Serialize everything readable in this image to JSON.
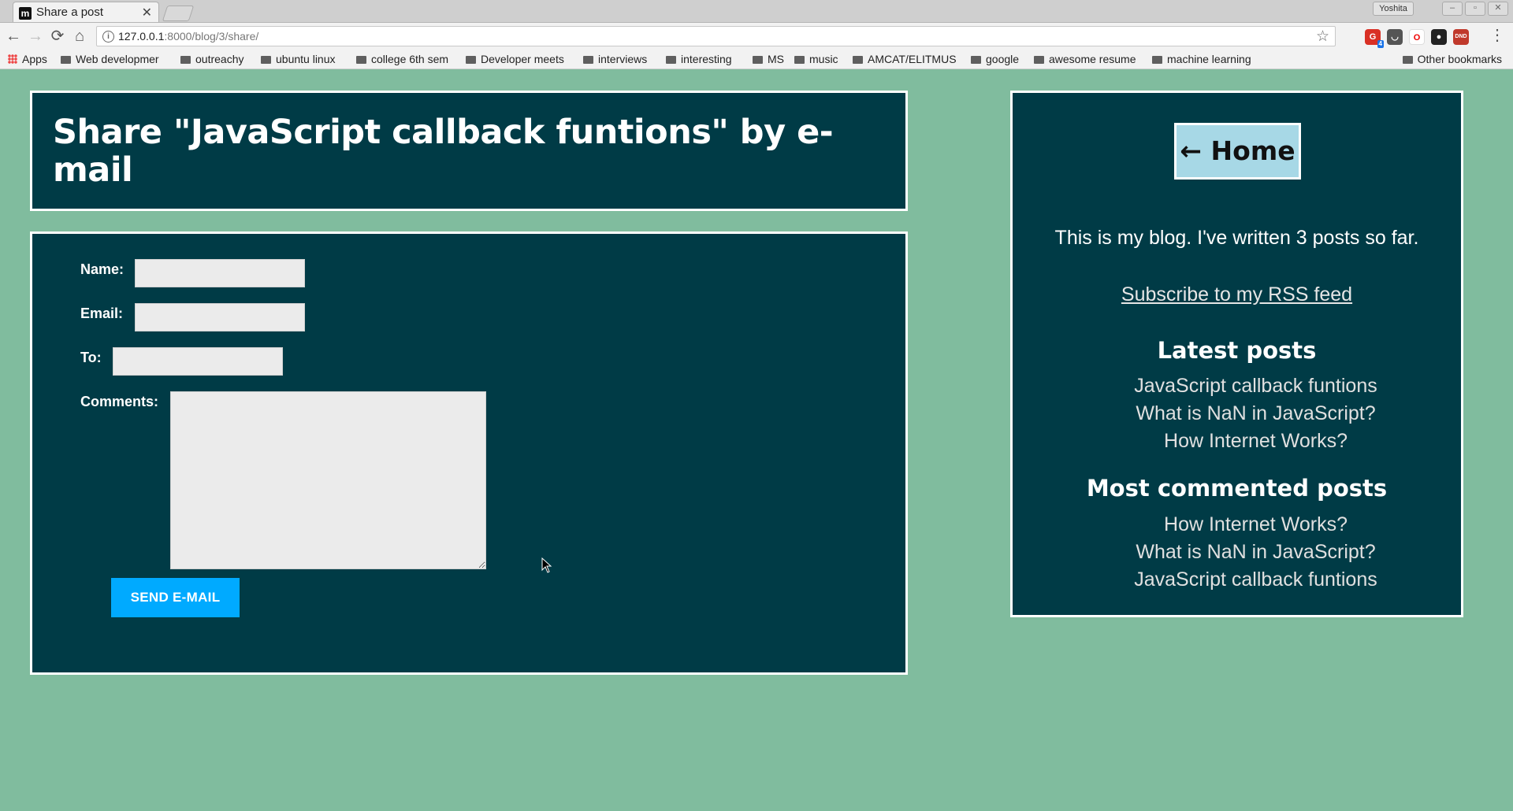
{
  "browser": {
    "tab": {
      "title": "Share a post",
      "close": "✕",
      "favicon": "m"
    },
    "profile": "Yoshita",
    "address": {
      "host": "127.0.0.1",
      "path": ":8000/blog/3/share/"
    },
    "bookmarks": {
      "apps": "Apps",
      "folders": [
        "Web developmer",
        "outreachy",
        "ubuntu linux",
        "college 6th sem",
        "Developer meets",
        "interviews",
        "interesting",
        "MS",
        "music",
        "AMCAT/ELITMUS",
        "google",
        "awesome resume",
        "machine learning"
      ],
      "other": "Other bookmarks"
    },
    "extensions": {
      "badge": "4",
      "dnd": "DND"
    }
  },
  "page": {
    "title": "Share \"JavaScript callback funtions\" by e-mail",
    "form": {
      "name_label": "Name:",
      "email_label": "Email:",
      "to_label": "To:",
      "comments_label": "Comments:",
      "submit_label": "SEND E-MAIL"
    },
    "sidebar": {
      "home_label": "← Home",
      "intro": "This is my blog. I've written 3 posts so far.",
      "rss_label": "Subscribe to my RSS feed",
      "latest_heading": "Latest posts",
      "latest_posts": [
        "JavaScript callback funtions",
        "What is NaN in JavaScript?",
        "How Internet Works?"
      ],
      "commented_heading": "Most commented posts",
      "commented_posts": [
        "How Internet Works?",
        "What is NaN in JavaScript?",
        "JavaScript callback funtions"
      ]
    }
  },
  "colors": {
    "page_bg": "#80bc9e",
    "panel_bg": "#003b46",
    "button_blue": "#00aaff",
    "home_bg": "#a7d8e6"
  }
}
